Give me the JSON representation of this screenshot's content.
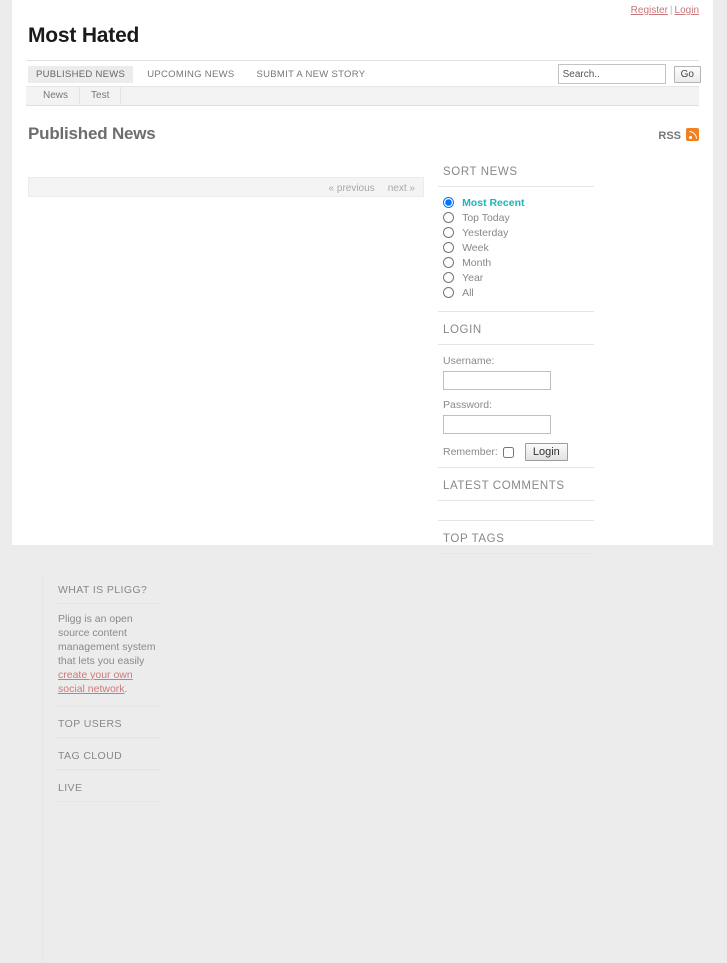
{
  "userbar": {
    "register_label": "Register",
    "separator": "|",
    "login_label": "Login"
  },
  "header": {
    "site_title": "Most Hated"
  },
  "mainnav": {
    "items": [
      {
        "label": "PUBLISHED NEWS",
        "active": true
      },
      {
        "label": "UPCOMING NEWS",
        "active": false
      },
      {
        "label": "SUBMIT A NEW STORY",
        "active": false
      }
    ]
  },
  "search": {
    "value": "Search..",
    "placeholder": "Search..",
    "go_label": "Go"
  },
  "subnav": {
    "items": [
      {
        "label": "News"
      },
      {
        "label": "Test"
      }
    ]
  },
  "page": {
    "title": "Published News",
    "rss_label": "RSS"
  },
  "pager": {
    "previous_label": "« previous",
    "next_label": "next »"
  },
  "sort_news": {
    "heading": "SORT NEWS",
    "options": [
      {
        "label": "Most Recent",
        "selected": true
      },
      {
        "label": "Top Today",
        "selected": false
      },
      {
        "label": "Yesterday",
        "selected": false
      },
      {
        "label": "Week",
        "selected": false
      },
      {
        "label": "Month",
        "selected": false
      },
      {
        "label": "Year",
        "selected": false
      },
      {
        "label": "All",
        "selected": false
      }
    ]
  },
  "login": {
    "heading": "LOGIN",
    "username_label": "Username:",
    "username_value": "",
    "password_label": "Password:",
    "password_value": "",
    "remember_label": "Remember:",
    "submit_label": "Login"
  },
  "latest_comments": {
    "heading": "LATEST COMMENTS"
  },
  "top_tags": {
    "heading": "TOP TAGS"
  },
  "what_is_pligg": {
    "heading": "WHAT IS PLIGG?",
    "text_before": "Pligg is an open source content management system that lets you easily ",
    "link_label": "create your own social network",
    "text_after": "."
  },
  "top_users": {
    "heading": "TOP USERS"
  },
  "tag_cloud": {
    "heading": "TAG CLOUD"
  },
  "live": {
    "heading": "LIVE"
  },
  "colors": {
    "accent_teal": "#1eb5b5",
    "link_red": "#cc7a7a",
    "rss_orange": "#f08020",
    "page_bg": "#ececec"
  }
}
